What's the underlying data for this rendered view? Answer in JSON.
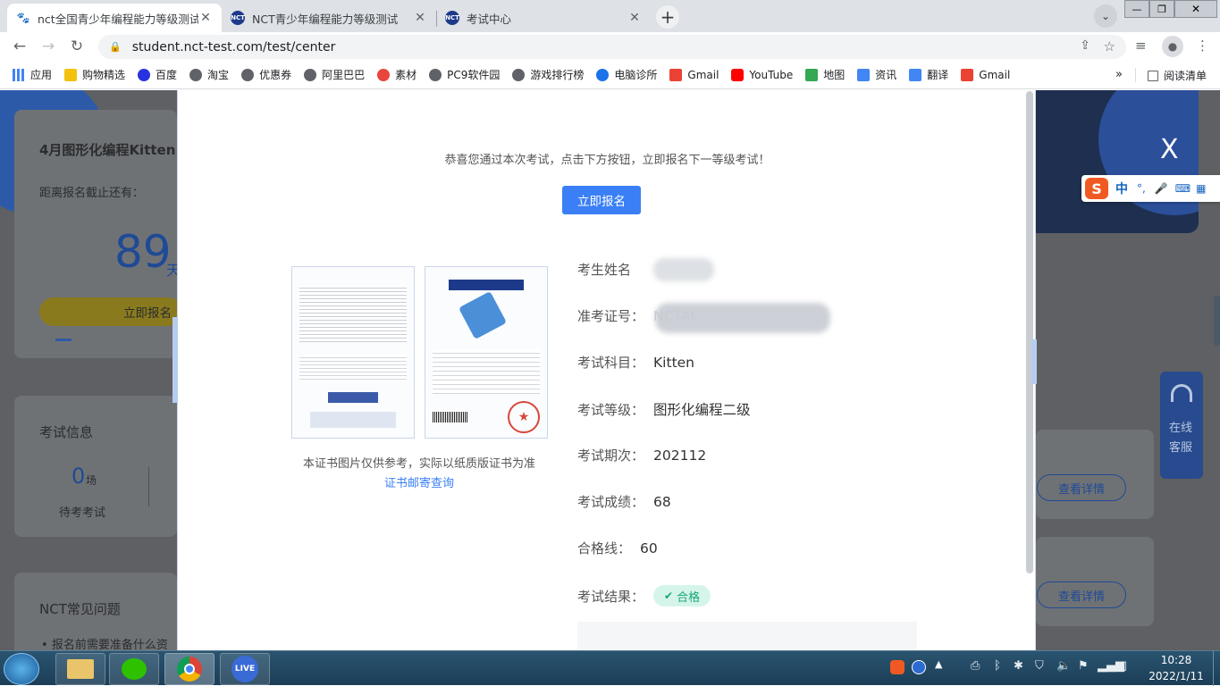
{
  "browser": {
    "tabs": [
      {
        "title": "nct全国青少年编程能力等级测试",
        "active": true
      },
      {
        "title": "NCT青少年编程能力等级测试",
        "active": false
      },
      {
        "title": "考试中心",
        "active": false
      }
    ],
    "url": "student.nct-test.com/test/center",
    "bookmarks": [
      "应用",
      "购物精选",
      "百度",
      "淘宝",
      "优惠券",
      "阿里巴巴",
      "素材",
      "PC9软件园",
      "游戏排行榜",
      "电脑诊所",
      "Gmail",
      "YouTube",
      "地图",
      "资讯",
      "翻译",
      "Gmail"
    ],
    "more": "»",
    "reading_list": "阅读清单"
  },
  "background": {
    "exam_title": "4月图形化编程Kitten",
    "countdown_label": "距离报名截止还有：",
    "days": "89",
    "days_unit": "天",
    "register_btn": "立即报名",
    "exam_info_title": "考试信息",
    "pending_count": "0",
    "pending_unit": "场",
    "pending_label": "待考考试",
    "faq_title": "NCT常见问题",
    "faq_item": "报名前需要准备什么资",
    "details_btn": "查看详情",
    "service": [
      "在线",
      "客服"
    ]
  },
  "modal": {
    "congrats": "恭喜您通过本次考试，点击下方按钮，立即报名下一等级考试！",
    "register_btn": "立即报名",
    "cert_note": "本证书图片仅供参考，实际以纸质版证书为准",
    "cert_link": "证书邮寄查询",
    "rows": [
      {
        "label": "考生姓名",
        "value": ""
      },
      {
        "label": "准考证号：",
        "value": "NCTAC"
      },
      {
        "label": "考试科目：",
        "value": "Kitten"
      },
      {
        "label": "考试等级：",
        "value": "图形化编程二级"
      },
      {
        "label": "考试期次：",
        "value": "202112"
      },
      {
        "label": "考试成绩：",
        "value": "68"
      },
      {
        "label": "合格线：",
        "value": "60"
      },
      {
        "label": "考试结果：",
        "value": ""
      }
    ],
    "result_badge": "合格",
    "close": "X"
  },
  "ime": {
    "lang": "中"
  },
  "taskbar": {
    "time": "10:28",
    "date": "2022/1/11",
    "live": "LIVE"
  },
  "colors": {
    "primary": "#3a7ff6",
    "success_bg": "#d6f5ea",
    "success": "#18a574",
    "overlay": "#5e6063"
  }
}
